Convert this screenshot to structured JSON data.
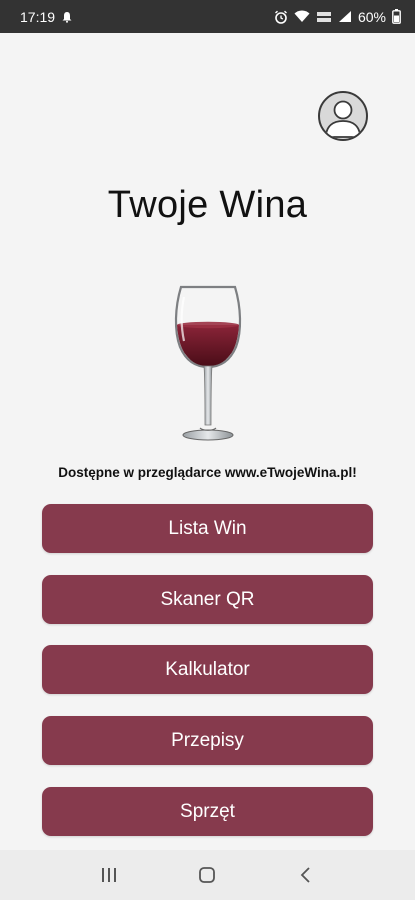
{
  "status_bar": {
    "time": "17:19",
    "battery": "60%",
    "icons": [
      "notification-icon",
      "alarm-icon",
      "wifi-icon",
      "volte-icon",
      "signal-icon",
      "battery-icon"
    ]
  },
  "header": {
    "profile_icon": "user-avatar-icon"
  },
  "main": {
    "title": "Twoje Wina",
    "image": "wine-glass",
    "browser_note": "Dostępne w przeglądarce www.eTwojeWina.pl!",
    "menu": [
      {
        "label": "Lista Win"
      },
      {
        "label": "Skaner QR"
      },
      {
        "label": "Kalkulator"
      },
      {
        "label": "Przepisy"
      },
      {
        "label": "Sprzęt"
      }
    ]
  },
  "nav_bar": {
    "buttons": [
      "recent-apps-icon",
      "home-icon",
      "back-icon"
    ]
  },
  "colors": {
    "status_bar": "#333333",
    "background": "#f4f4f4",
    "accent_button": "#863a4d",
    "wine": "#7a1c2e"
  }
}
